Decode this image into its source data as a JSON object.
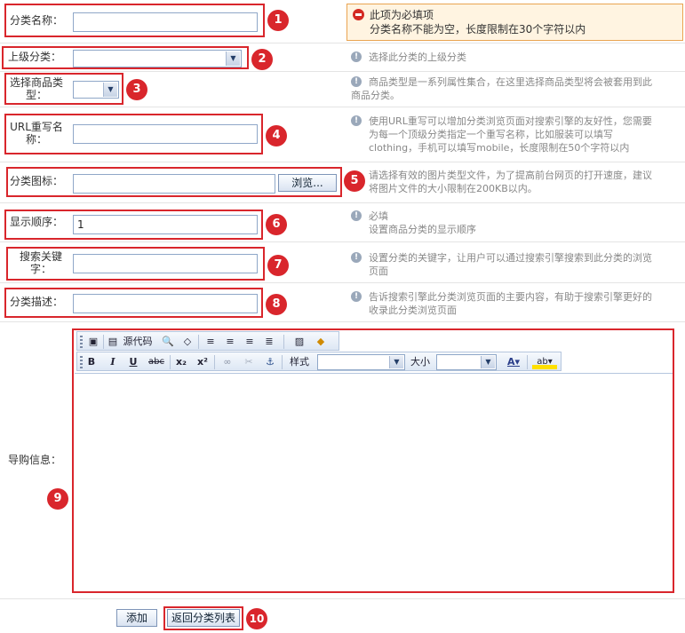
{
  "form": {
    "name_label": "分类名称：",
    "parent_label": "上级分类：",
    "type_label": "选择商品类型：",
    "url_label": "URL重写名称：",
    "icon_label": "分类图标：",
    "order_label": "显示顺序：",
    "keyword_label": "搜索关键字：",
    "desc_label": "分类描述：",
    "guide_label": "导购信息：",
    "order_value": "1",
    "browse_button": "浏览..."
  },
  "error": {
    "title": "此项为必填项",
    "message": "分类名称不能为空，长度限制在30个字符以内"
  },
  "hints": {
    "parent": "选择此分类的上级分类",
    "type_1": "商品类型是一系列属性集合，在这里选择商品类型将会被套用到此",
    "type_2": "商品分类。",
    "url_1": "使用URL重写可以增加分类浏览页面对搜索引擎的友好性，您需要",
    "url_2": "为每一个顶级分类指定一个重写名称，比如服装可以填写",
    "url_3": "clothing，手机可以填写mobile，长度限制在50个字符以内",
    "icon_1": "请选择有效的图片类型文件，为了提高前台网页的打开速度，建议",
    "icon_2": "将图片文件的大小限制在200KB以内。",
    "order_1": "必填",
    "order_2": "设置商品分类的显示顺序",
    "keyword_1": "设置分类的关键字，让用户可以通过搜索引擎搜索到此分类的浏览",
    "keyword_2": "页面",
    "desc_1": "告诉搜索引擎此分类浏览页面的主要内容，有助于搜索引擎更好的",
    "desc_2": "收录此分类浏览页面"
  },
  "editor": {
    "source_label": "源代码",
    "style_label": "样式",
    "size_label": "大小"
  },
  "buttons": {
    "add": "添加",
    "back": "返回分类列表"
  },
  "badges": [
    "1",
    "2",
    "3",
    "4",
    "5",
    "6",
    "7",
    "8",
    "9",
    "10"
  ],
  "colors": {
    "annotation": "#d9262c",
    "error_bg": "#fff4e1",
    "input_border": "#8fa7c8"
  }
}
